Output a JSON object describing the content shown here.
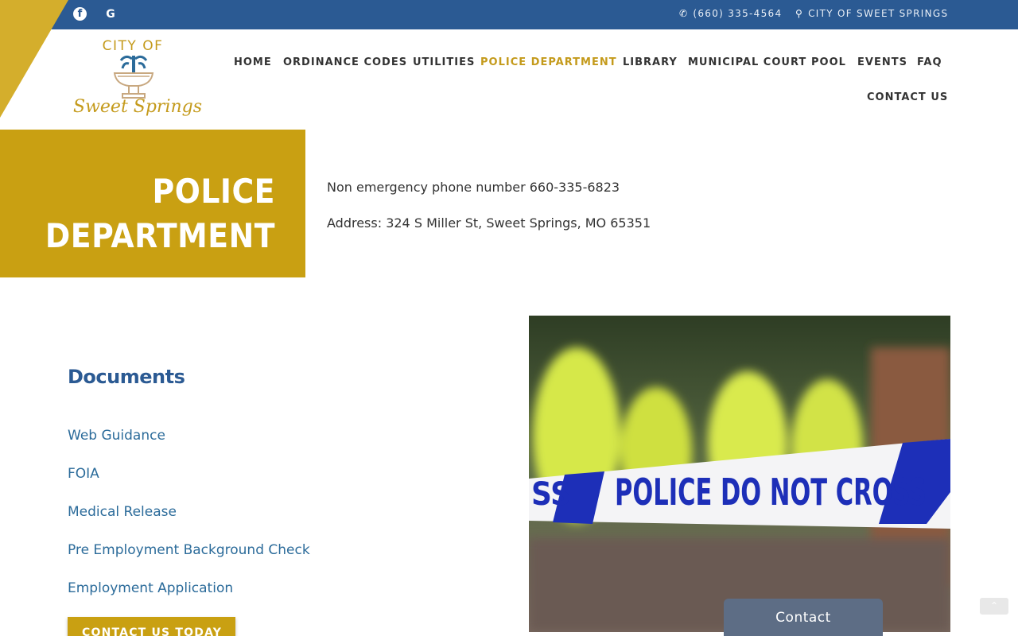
{
  "topbar": {
    "phone": "(660) 335-4564",
    "city": "CITY OF SWEET SPRINGS",
    "facebook_icon": "f",
    "google_icon": "G",
    "bar_color": "#2b5a93",
    "corner_color": "#d4ae2c"
  },
  "logo": {
    "top_text": "CITY OF",
    "bottom_text": "Sweet Springs"
  },
  "nav": {
    "items": [
      "HOME",
      "ORDINANCE CODES",
      "UTILITIES",
      "POLICE DEPARTMENT",
      "LIBRARY",
      "MUNICIPAL COURT",
      "POOL",
      "EVENTS",
      "FAQ",
      "CONTACT US"
    ],
    "active": "POLICE DEPARTMENT"
  },
  "hero": {
    "title": "POLICE DEPARTMENT",
    "phone_line": "Non emergency phone number 660-335-6823",
    "address_line": "Address: 324 S Miller St, Sweet Springs, MO 65351",
    "accent_color": "#c9a012"
  },
  "documents": {
    "heading": "Documents",
    "links": [
      "Web Guidance",
      "FOIA",
      "Medical Release",
      "Pre Employment Background Check",
      "Employment Application"
    ],
    "cta_label": "CONTACT US TODAY"
  },
  "photo": {
    "tape_text": "POLICE DO NOT CROSS",
    "tape_prefix": "SS"
  },
  "widget": {
    "contact_label": "Contact",
    "scroll_top_icon": "chevron-up-icon"
  }
}
